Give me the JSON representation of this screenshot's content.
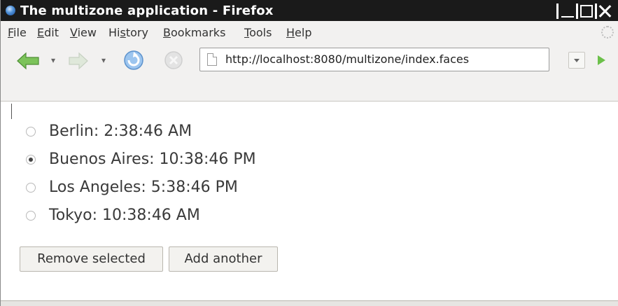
{
  "window": {
    "title": "The multizone application - Firefox"
  },
  "menu": [
    {
      "pre": "",
      "u": "F",
      "post": "ile"
    },
    {
      "pre": "",
      "u": "E",
      "post": "dit"
    },
    {
      "pre": "",
      "u": "V",
      "post": "iew"
    },
    {
      "pre": "Hi",
      "u": "s",
      "post": "tory"
    },
    {
      "pre": "",
      "u": "B",
      "post": "ookmarks"
    },
    {
      "pre": "",
      "u": "T",
      "post": "ools"
    },
    {
      "pre": "",
      "u": "H",
      "post": "elp"
    }
  ],
  "navigation": {
    "url": "http://localhost:8080/multizone/index.faces"
  },
  "zones": [
    {
      "label": "Berlin: 2:38:46 AM",
      "selected": false
    },
    {
      "label": "Buenos Aires: 10:38:46 PM",
      "selected": true
    },
    {
      "label": "Los Angeles: 5:38:46 PM",
      "selected": false
    },
    {
      "label": "Tokyo: 10:38:46 AM",
      "selected": false
    }
  ],
  "buttons": {
    "remove": "Remove selected",
    "add": "Add another"
  },
  "icons": {
    "back": "back-arrow-icon",
    "forward": "forward-arrow-icon",
    "reload": "reload-icon",
    "stop": "stop-icon",
    "page": "page-icon",
    "go": "go-arrow-icon"
  }
}
